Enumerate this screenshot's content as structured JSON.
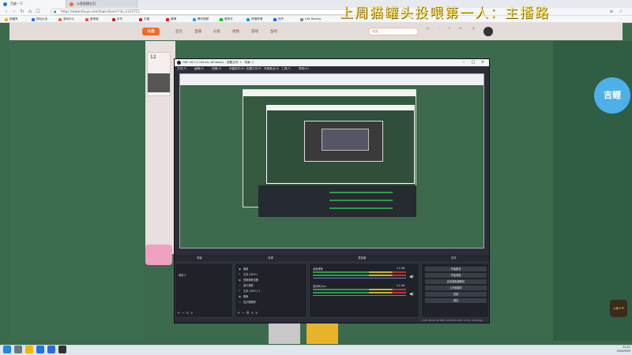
{
  "browser": {
    "tabs": [
      {
        "label": "百度一下",
        "color": "#2d6be4"
      },
      {
        "label": "斗鱼直播主页",
        "color": "#f06a2a"
      }
    ],
    "url": "https://www.douyu.com/topic/dyxm?rid=1213715",
    "bookmarks": [
      {
        "label": "收藏夹",
        "color": "#f4b400"
      },
      {
        "label": "网址大全",
        "color": "#2d6be4"
      },
      {
        "label": "游戏中心",
        "color": "#f06a2a"
      },
      {
        "label": "爱淘宝",
        "color": "#f24f3d"
      },
      {
        "label": "京东",
        "color": "#d21b1b"
      },
      {
        "label": "天猫",
        "color": "#d21b1b"
      },
      {
        "label": "微博",
        "color": "#e6162d"
      },
      {
        "label": "腾讯视频",
        "color": "#1aa0f0"
      },
      {
        "label": "爱奇艺",
        "color": "#00be06"
      },
      {
        "label": "哔哩哔哩",
        "color": "#00a1d6"
      },
      {
        "label": "知乎",
        "color": "#0066ff"
      },
      {
        "label": "Life Review",
        "color": "#888888"
      }
    ]
  },
  "overlay": {
    "title": "上周猫罐头投喂第一人：主播路"
  },
  "douyu": {
    "nav": [
      "首页",
      "直播",
      "分类",
      "视频",
      "游戏",
      "鱼吧"
    ],
    "search_placeholder": "搜索",
    "room_number": "12",
    "right_logo": "吉鲤",
    "corner_badge": "斗鱼TOP"
  },
  "obs": {
    "title": "OBS 26.0.2 (64-bit, windows) - 配置文件: 1 - 场景: 2",
    "menu": [
      "文件(F)",
      "编辑(E)",
      "视图(V)",
      "停靠部件(D)",
      "配置文件(P)",
      "场景集合(S)",
      "工具(T)",
      "帮助(H)"
    ],
    "docks": {
      "scenes_title": "场景",
      "sources_title": "来源",
      "mixer_title": "混音器",
      "controls_title": "控件"
    },
    "scenes": [
      "场景 2"
    ],
    "sources": [
      "图像",
      "文本 (GDI+)",
      "视频捕获设备",
      "窗口捕获",
      "文本 (GDI+) 2",
      "图像",
      "显示器捕获"
    ],
    "mixer": [
      {
        "label": "桌面音频",
        "db": "0.0 dB"
      },
      {
        "label": "麦克风/Aux",
        "db": "0.0 dB"
      }
    ],
    "controls": [
      "开始推流",
      "开始录制",
      "启动虚拟摄像机",
      "工作室模式",
      "设置",
      "退出"
    ],
    "status": "LIVE: 00:00:00  REC: 00:00:00  CPU: 2.0%, 30.00 fps"
  },
  "taskbar": {
    "time": "21:21",
    "date": "2020/9/29",
    "apps": [
      {
        "name": "windows-icon",
        "color": "#1e88e5"
      },
      {
        "name": "search-icon",
        "color": "#6d7781"
      },
      {
        "name": "folder-icon",
        "color": "#f4b400"
      },
      {
        "name": "edge-icon",
        "color": "#1a73e8"
      },
      {
        "name": "browser-icon",
        "color": "#2d6be4"
      },
      {
        "name": "obs-icon",
        "color": "#333333"
      }
    ]
  }
}
